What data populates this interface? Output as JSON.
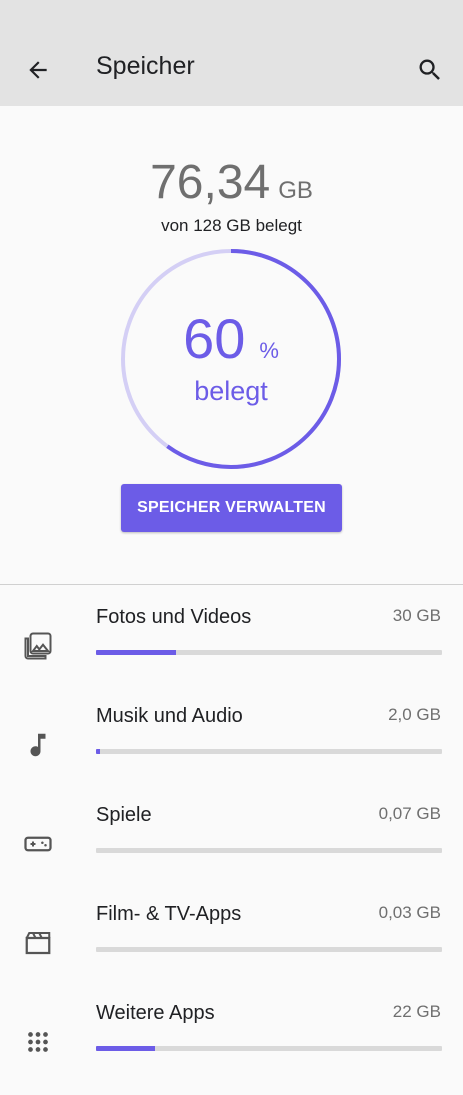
{
  "header": {
    "title": "Speicher"
  },
  "summary": {
    "used_value": "76,34",
    "used_unit": "GB",
    "used_of": "von 128 GB belegt",
    "percent_value": "60",
    "percent_symbol": "%",
    "percent_label": "belegt",
    "used_fraction": 0.6
  },
  "manage_button": {
    "label": "SPEICHER VERWALTEN"
  },
  "accent_color": "#6c5ce7",
  "categories": [
    {
      "label": "Fotos und Videos",
      "size": "30 GB",
      "fill_fraction": 0.23,
      "icon": "photo-library-icon"
    },
    {
      "label": "Musik und Audio",
      "size": "2,0 GB",
      "fill_fraction": 0.012,
      "icon": "music-note-icon"
    },
    {
      "label": "Spiele",
      "size": "0,07 GB",
      "fill_fraction": 0.0,
      "icon": "gamepad-icon"
    },
    {
      "label": "Film- & TV-Apps",
      "size": "0,03 GB",
      "fill_fraction": 0.0,
      "icon": "movie-icon"
    },
    {
      "label": "Weitere Apps",
      "size": "22 GB",
      "fill_fraction": 0.17,
      "icon": "apps-grid-icon"
    }
  ]
}
